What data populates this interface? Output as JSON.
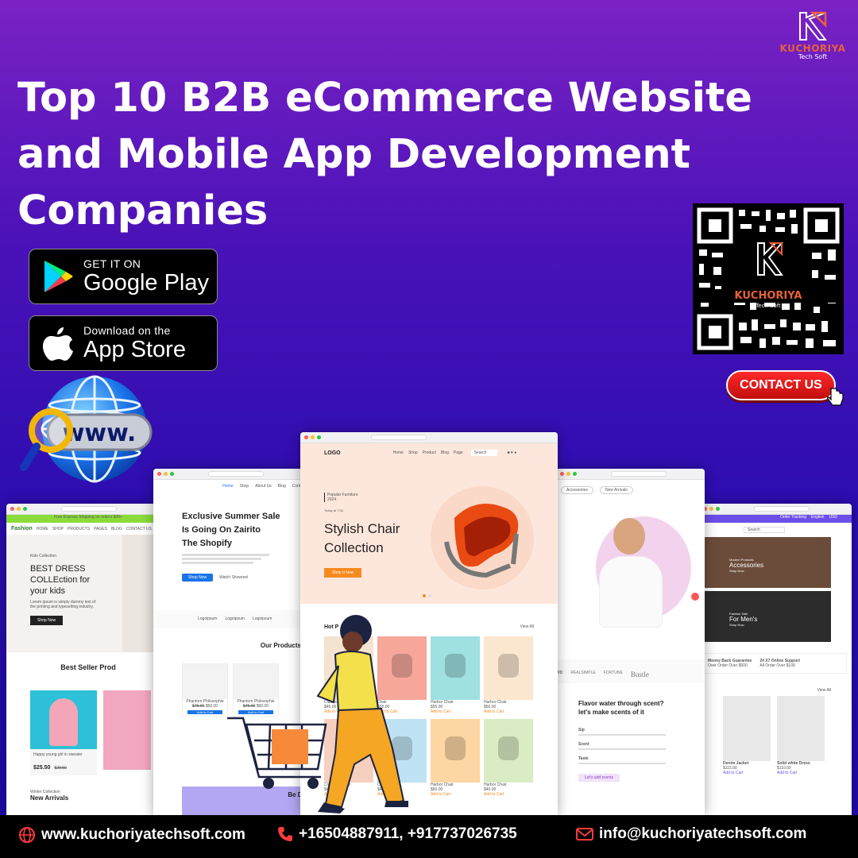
{
  "brand": {
    "name": "KUCHORIYA",
    "sub": "Tech Soft",
    "accent": "#e8613a"
  },
  "headline": {
    "lines": [
      "Top 10 B2B eCommerce Website",
      "and Mobile App Development",
      "Companies"
    ]
  },
  "stores": {
    "google_small": "GET IT ON",
    "google_big": "Google Play",
    "apple_small": "Download on the",
    "apple_big": "App Store"
  },
  "globe_text": "www.",
  "qr": {
    "name": "KUCHORIYA",
    "sub": "Tech Soft"
  },
  "contact_label": "CONTACT US",
  "mockups": {
    "kids": {
      "banner": "Free Express Shipping on orders $99+",
      "brand": "Fashion",
      "nav": [
        "HOME",
        "SHOP",
        "PRODUCTS",
        "PAGES",
        "BLOG",
        "CONTACT US"
      ],
      "eyebrow": "Kids Collection",
      "hero": [
        "BEST DRESS",
        "COLLEction for",
        "your kids"
      ],
      "body": "Lorem ipsum is simply dummy text of the printing and typesetting industry.",
      "cta": "Shop Now",
      "section": "Best Seller Prod",
      "product": "Happy young girl in sweater",
      "price": "$25.50",
      "old_price": "$29.50",
      "footer_eyebrow": "Winter Collection",
      "footer_title": "New Arrivals"
    },
    "summer": {
      "nav": [
        "Home",
        "Shop",
        "About Us",
        "Blog",
        "Contact"
      ],
      "title": [
        "Exclusive Summer Sale",
        "Is Going On Zairito",
        "The Shopify"
      ],
      "cta": "Shop Now",
      "secondary": "Watch Showreel",
      "logos": [
        "Logoipsum",
        "Logoipsum",
        "Logoipsum"
      ],
      "section": "Our Products",
      "products": [
        {
          "name": "Phantom Philosophie",
          "price": "$50.00",
          "old": "$75.00"
        },
        {
          "name": "Phantom Philosophie",
          "price": "$60.00",
          "old": "$75.00"
        }
      ],
      "cart": "Add to Cart",
      "promo": "Be De"
    },
    "chair": {
      "logo": "LOGO",
      "nav": [
        "Home",
        "Shop",
        "Product",
        "Blog",
        "Page"
      ],
      "search": "Search",
      "eyebrow": "Popular Furniture",
      "year": "2024",
      "tag": "Today at 7:00",
      "hero": [
        "Stylish Chair",
        "Collection"
      ],
      "cta": "Shop It Now",
      "section": "Hot P",
      "view_all": "View All",
      "products": [
        {
          "name": "Classical Chair",
          "price": "$45.00",
          "link": "Add to Cart",
          "bg": "#f3e3cf"
        },
        {
          "name": "Chair",
          "price": "$55.00",
          "link": "Add to Cart",
          "bg": "#f6a79a"
        },
        {
          "name": "Harbor Chair",
          "price": "$55.00",
          "link": "Add to Cart",
          "bg": "#9fe0e0"
        },
        {
          "name": "Harbor Chair",
          "price": "$50.00",
          "link": "Add to Cart",
          "bg": "#fbe6cf"
        },
        {
          "name": "Classical Chair",
          "price": "$45.00",
          "link": "Add to Cart",
          "bg": "#f6d0bf"
        },
        {
          "name": "Chair",
          "price": "$60.00",
          "link": "Add to Cart",
          "bg": "#bfe3f5"
        },
        {
          "name": "Harbor Chair",
          "price": "$60.00",
          "link": "Add to Cart",
          "bg": "#fdd6a3"
        },
        {
          "name": "Harbor Chair",
          "price": "$40.00",
          "link": "Add to Cart",
          "bg": "#d9ecc3"
        }
      ]
    },
    "water": {
      "tabs": [
        "Accessories",
        "New Arrivals"
      ],
      "brands": [
        "WD",
        "REALSIMPLE",
        "FORTUNE",
        "Bustle"
      ],
      "title": [
        "Flavor water through scent?",
        "let's make scents of it"
      ],
      "features": [
        "Sip",
        "Scent",
        "Taste"
      ],
      "cta": "Let's add scents"
    },
    "men": {
      "topbar": [
        "Order Tracking",
        "English",
        "USD"
      ],
      "search": "Search",
      "cards": [
        {
          "eyebrow": "Modern Products",
          "title": "Accessories",
          "link": "Shop Now"
        },
        {
          "eyebrow": "Fashion Sale",
          "title": "For Men's",
          "link": "Shop Now"
        }
      ],
      "features": [
        {
          "title": "Money Back Guarantee",
          "sub": "Over Order Over $500"
        },
        {
          "title": "24 X7 Online Support",
          "sub": "All Order Over $100"
        }
      ],
      "view_all": "View All",
      "products": [
        {
          "name": "Denim Jacket",
          "price": "$115.00",
          "link": "Add to Cart"
        },
        {
          "name": "Solid white Dress",
          "price": "$110.00",
          "link": "Add to Cart"
        }
      ]
    }
  },
  "footer": {
    "website": "www.kuchoriyatechsoft.com",
    "phone": "+16504887911, +917737026735",
    "email": "info@kuchoriyatechsoft.com"
  }
}
